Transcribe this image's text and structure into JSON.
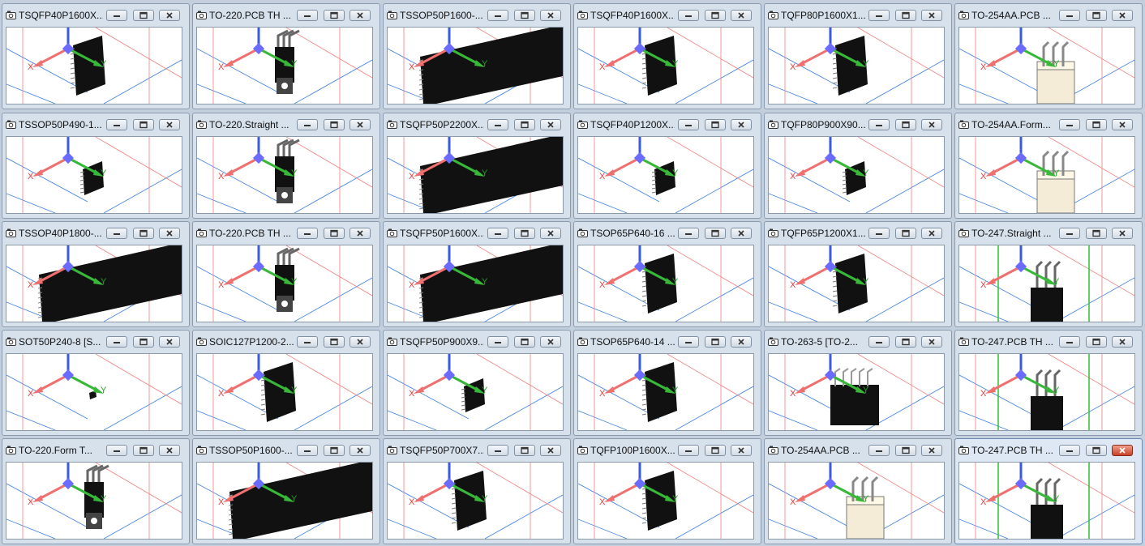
{
  "windows": [
    {
      "title": "TSQFP40P1600X...",
      "close_style": "normal",
      "model": "chip-dark"
    },
    {
      "title": "TO-220.PCB TH ...",
      "close_style": "normal",
      "model": "to220"
    },
    {
      "title": "TSSOP50P1600-...",
      "close_style": "normal",
      "model": "chip-big"
    },
    {
      "title": "TSQFP40P1600X...",
      "close_style": "normal",
      "model": "chip-dark"
    },
    {
      "title": "TQFP80P1600X1...",
      "close_style": "normal",
      "model": "chip-dark"
    },
    {
      "title": "TO-254AA.PCB ...",
      "close_style": "normal",
      "model": "to254"
    },
    {
      "title": "TSSOP50P490-1...",
      "close_style": "normal",
      "model": "chip-small"
    },
    {
      "title": "TO-220.Straight ...",
      "close_style": "normal",
      "model": "to220"
    },
    {
      "title": "TSQFP50P2200X...",
      "close_style": "normal",
      "model": "chip-big"
    },
    {
      "title": "TSQFP40P1200X...",
      "close_style": "normal",
      "model": "chip-small"
    },
    {
      "title": "TQFP80P900X90...",
      "close_style": "normal",
      "model": "chip-small"
    },
    {
      "title": "TO-254AA.Form...",
      "close_style": "normal",
      "model": "to254"
    },
    {
      "title": "TSSOP40P1800-...",
      "close_style": "normal",
      "model": "chip-big"
    },
    {
      "title": "TO-220.PCB TH ...",
      "close_style": "normal",
      "model": "to220"
    },
    {
      "title": "TSQFP50P1600X...",
      "close_style": "normal",
      "model": "chip-big"
    },
    {
      "title": "TSOP65P640-16 ...",
      "close_style": "normal",
      "model": "chip-dark"
    },
    {
      "title": "TQFP65P1200X1...",
      "close_style": "normal",
      "model": "chip-dark"
    },
    {
      "title": "TO-247.Straight ...",
      "close_style": "normal",
      "model": "to247"
    },
    {
      "title": "SOT50P240-8 [S...",
      "close_style": "normal",
      "model": "chip-tiny"
    },
    {
      "title": "SOIC127P1200-2...",
      "close_style": "normal",
      "model": "chip-dark"
    },
    {
      "title": "TSQFP50P900X9...",
      "close_style": "normal",
      "model": "chip-small"
    },
    {
      "title": "TSOP65P640-14 ...",
      "close_style": "normal",
      "model": "chip-dark"
    },
    {
      "title": "TO-263-5 [TO-2...",
      "close_style": "normal",
      "model": "to263"
    },
    {
      "title": "TO-247.PCB TH ...",
      "close_style": "normal",
      "model": "to247"
    },
    {
      "title": "TO-220.Form T...",
      "close_style": "normal",
      "model": "to220"
    },
    {
      "title": "TSSOP50P1600-...",
      "close_style": "normal",
      "model": "chip-big"
    },
    {
      "title": "TSQFP50P700X7...",
      "close_style": "normal",
      "model": "chip-dark"
    },
    {
      "title": "TQFP100P1600X...",
      "close_style": "normal",
      "model": "chip-dark"
    },
    {
      "title": "TO-254AA.PCB ...",
      "close_style": "normal",
      "model": "to254"
    },
    {
      "title": "TO-247.PCB TH ...",
      "close_style": "red",
      "model": "to247",
      "active": true
    }
  ],
  "axis_labels": {
    "x": "X",
    "y": "Y"
  },
  "colors": {
    "x_axis": "#f07070",
    "y_axis": "#38b838",
    "z_axis": "#3a5be0",
    "origin": "#6b6bff",
    "grid_red": "#f08080",
    "grid_blue": "#3d7fe0",
    "grid_green": "#2cc32c",
    "chip": "#111111",
    "close_red": "#c74128"
  },
  "icons": {
    "window": "camera-icon",
    "minimize": "minimize-icon",
    "restore": "restore-icon",
    "close": "close-icon"
  }
}
